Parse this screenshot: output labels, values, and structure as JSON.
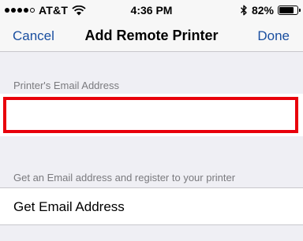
{
  "status_bar": {
    "carrier": "AT&T",
    "time": "4:36 PM",
    "battery": "82%",
    "battery_level": 0.82,
    "signal_bars": 4,
    "signal_total": 5
  },
  "nav": {
    "cancel_label": "Cancel",
    "title": "Add Remote Printer",
    "done_label": "Done"
  },
  "form": {
    "email_header": "Printer's Email Address",
    "email_value": "",
    "email_placeholder": "",
    "footer_text": "Get an Email address and register to your printer",
    "get_email_label": "Get Email Address"
  },
  "colors": {
    "accent": "#1a4fa0",
    "highlight": "#e8000b",
    "background": "#efeff4"
  }
}
